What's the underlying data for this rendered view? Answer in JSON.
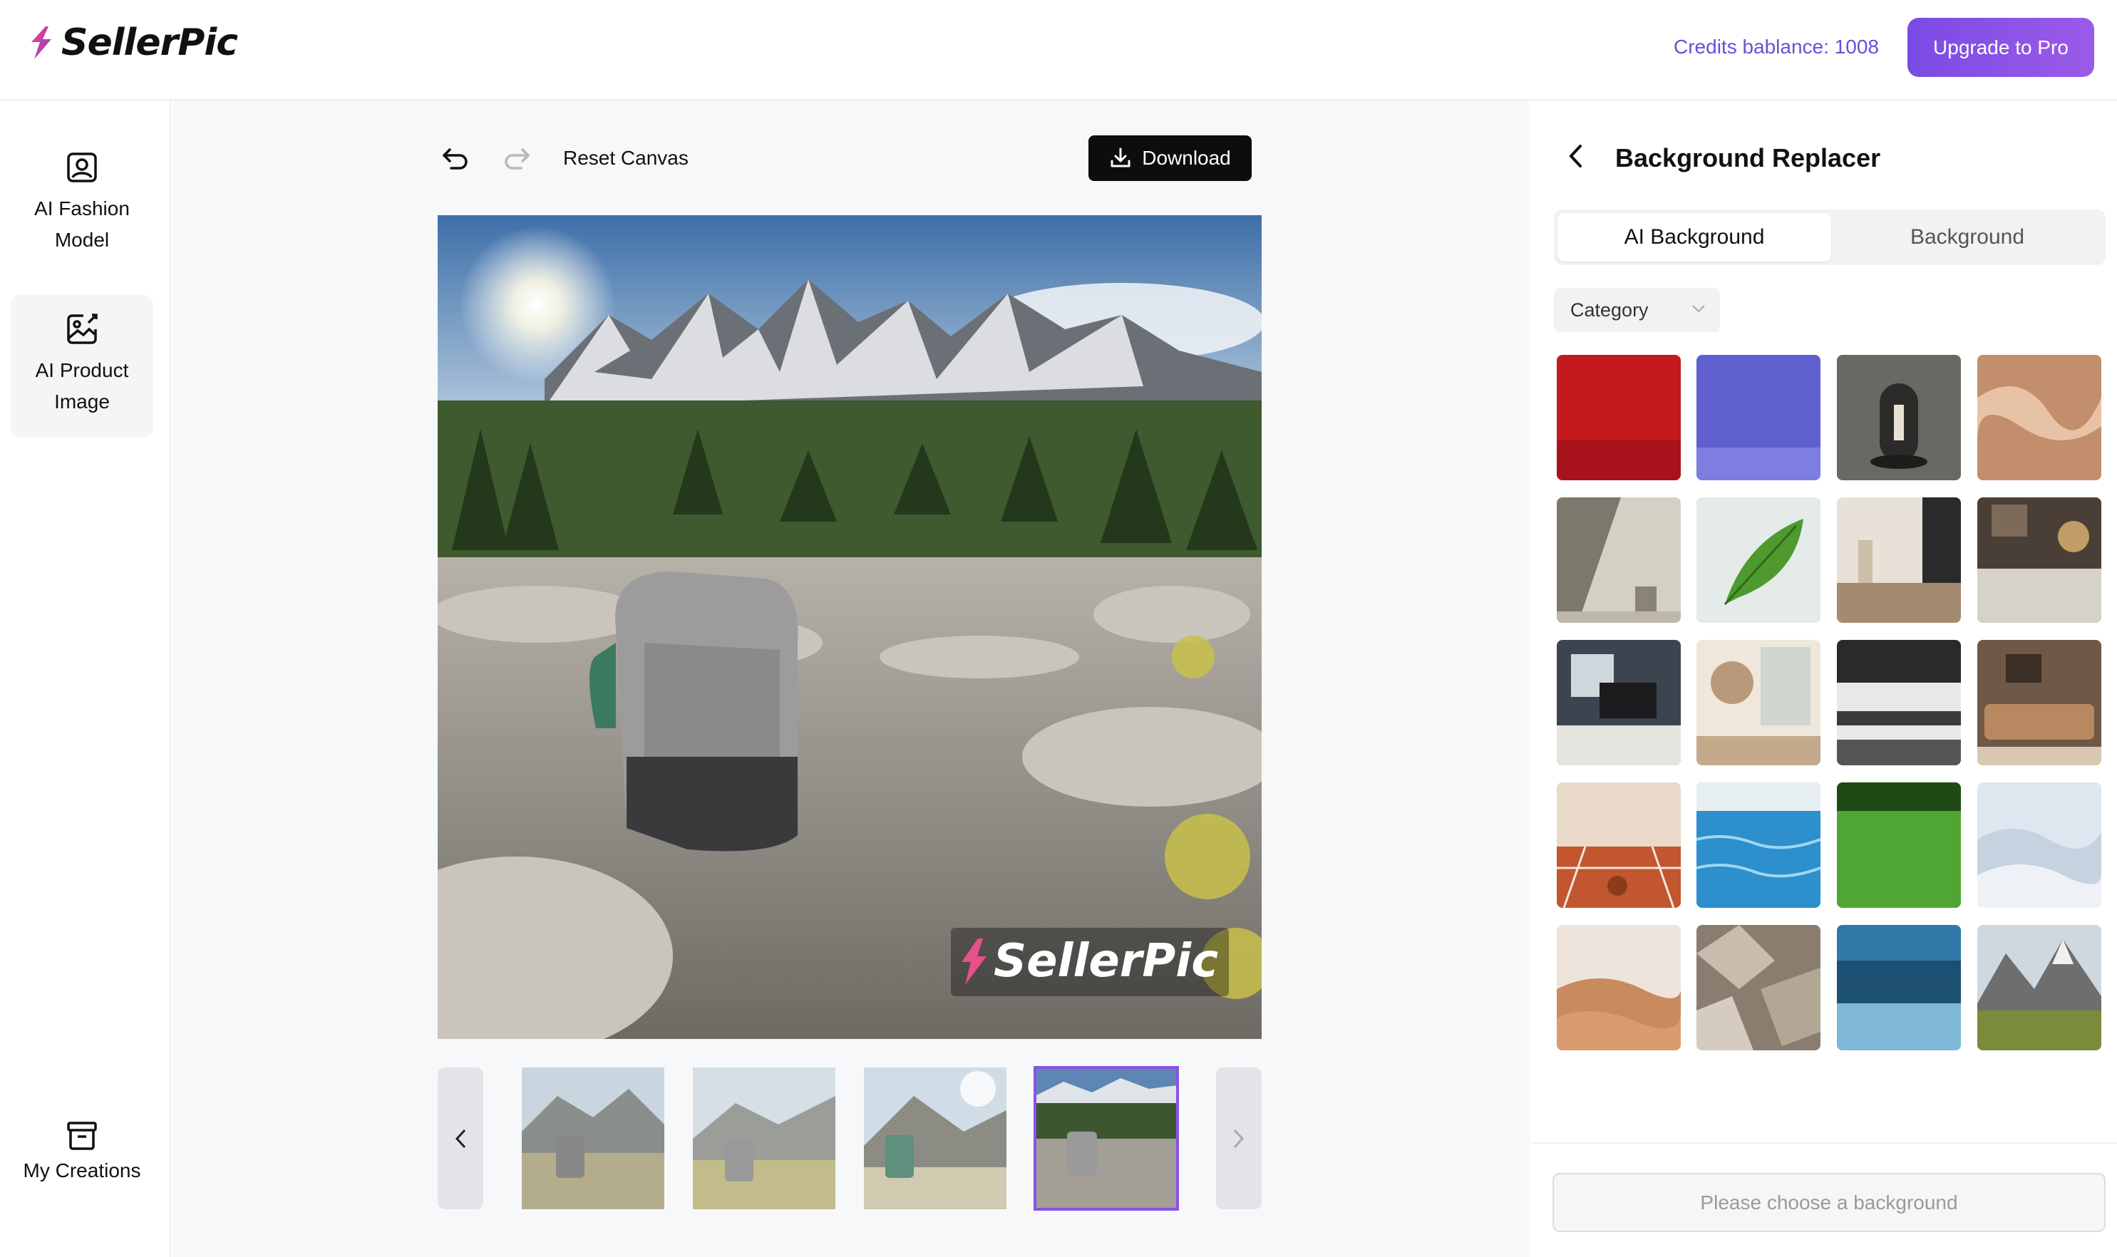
{
  "header": {
    "logo_text": "SellerPic",
    "credits_label": "Credits bablance: 1008",
    "upgrade_label": "Upgrade to Pro"
  },
  "sidebar": {
    "items": [
      {
        "label": "AI Fashion Model",
        "icon": "person-card-icon"
      },
      {
        "label": "AI Product Image",
        "icon": "image-edit-icon",
        "active": true
      },
      {
        "label": "My Creations",
        "icon": "archive-box-icon"
      }
    ]
  },
  "canvas": {
    "undo_icon": "undo-icon",
    "redo_icon": "redo-icon",
    "reset_label": "Reset Canvas",
    "download_label": "Download",
    "watermark_text": "SellerPic",
    "thumbnails_count": 4,
    "selected_thumbnail": 4
  },
  "panel": {
    "title": "Background Replacer",
    "tabs": [
      {
        "label": "AI Background",
        "active": true
      },
      {
        "label": "Background",
        "active": false
      }
    ],
    "category_label": "Category",
    "tiles": [
      "red-studio",
      "purple-studio",
      "dark-pedestal",
      "satin-fabric",
      "shadow-wall",
      "green-leaf",
      "kitchen-table",
      "bedroom",
      "office-desk",
      "flower-room",
      "kitchen-shelf",
      "living-sofa",
      "tennis-court",
      "pool-water",
      "grass-field",
      "snow-dunes",
      "desert-dunes",
      "rocks",
      "underwater",
      "mountain-valley"
    ],
    "choose_label": "Please choose a background"
  },
  "colors": {
    "accent": "#7a4be4",
    "credits_text": "#6b4fd6",
    "download_bg": "#0d0d0d"
  }
}
